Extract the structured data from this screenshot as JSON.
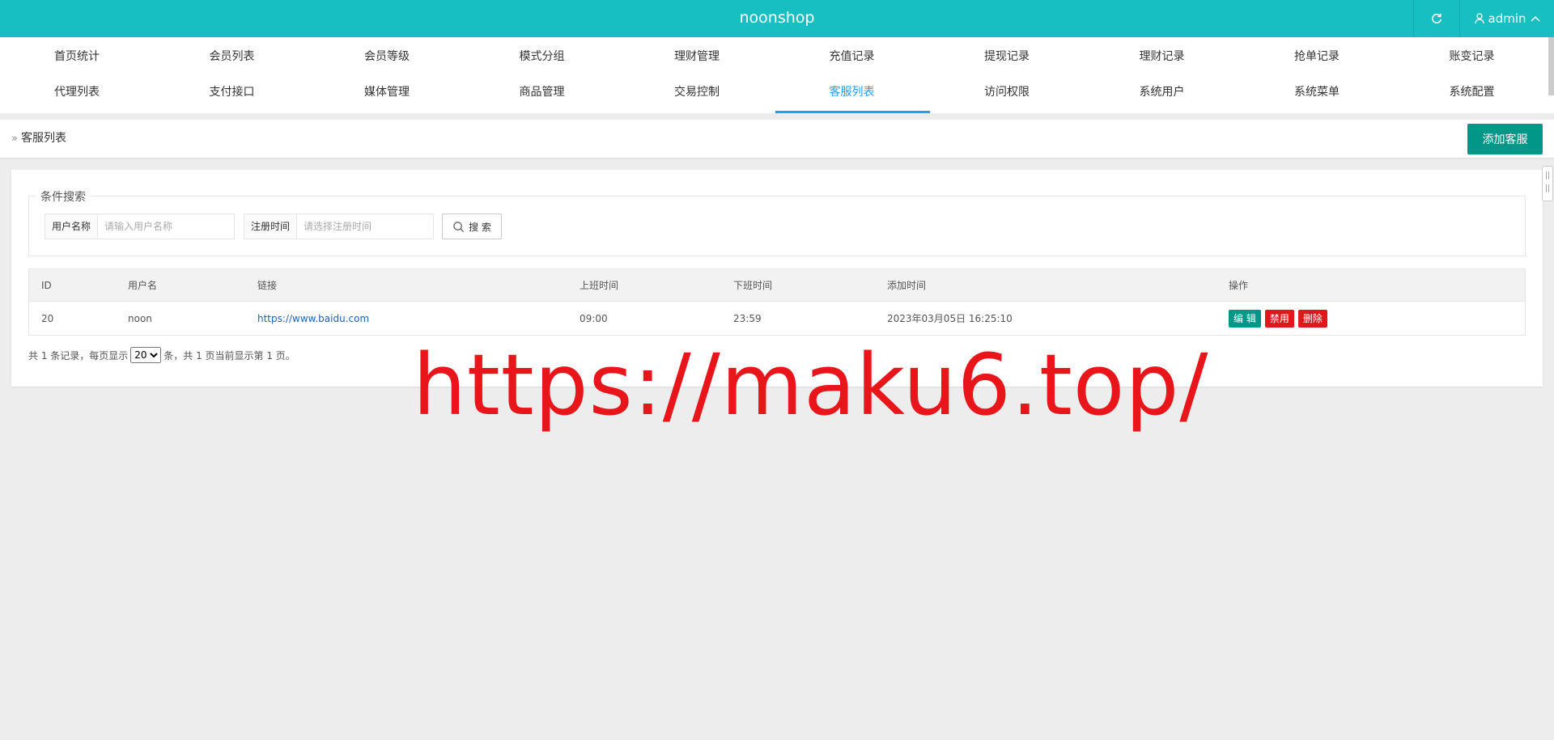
{
  "app": {
    "title": "noonshop",
    "user": "admin"
  },
  "colors": {
    "header": "#17bfc3",
    "accent": "#1e9fff",
    "primary_button": "#009688",
    "danger": "#e0181b"
  },
  "nav": {
    "row1": [
      "首页统计",
      "会员列表",
      "会员等级",
      "模式分组",
      "理财管理",
      "充值记录",
      "提现记录",
      "理财记录",
      "抢单记录",
      "账变记录"
    ],
    "row2": [
      "代理列表",
      "支付接口",
      "媒体管理",
      "商品管理",
      "交易控制",
      "客服列表",
      "访问权限",
      "系统用户",
      "系统菜单",
      "系统配置"
    ],
    "active": "客服列表"
  },
  "breadcrumb": {
    "current": "客服列表"
  },
  "toolbar": {
    "add_label": "添加客服"
  },
  "search": {
    "legend": "条件搜索",
    "username_label": "用户名称",
    "username_placeholder": "请输入用户名称",
    "regtime_label": "注册时间",
    "regtime_placeholder": "请选择注册时间",
    "button_label": "搜 索"
  },
  "table": {
    "headers": [
      "ID",
      "用户名",
      "链接",
      "上班时间",
      "下班时间",
      "添加时间",
      "操作"
    ],
    "rows": [
      {
        "id": "20",
        "username": "noon",
        "link": "https://www.baidu.com",
        "on_time": "09:00",
        "off_time": "23:59",
        "added": "2023年03月05日 16:25:10"
      }
    ],
    "actions": {
      "edit": "编 辑",
      "disable": "禁用",
      "delete": "删除"
    }
  },
  "pager": {
    "prefix": "共 1 条记录，每页显示",
    "page_size": "20",
    "suffix": "条，共 1 页当前显示第 1 页。"
  },
  "watermark": "https://maku6.top/"
}
